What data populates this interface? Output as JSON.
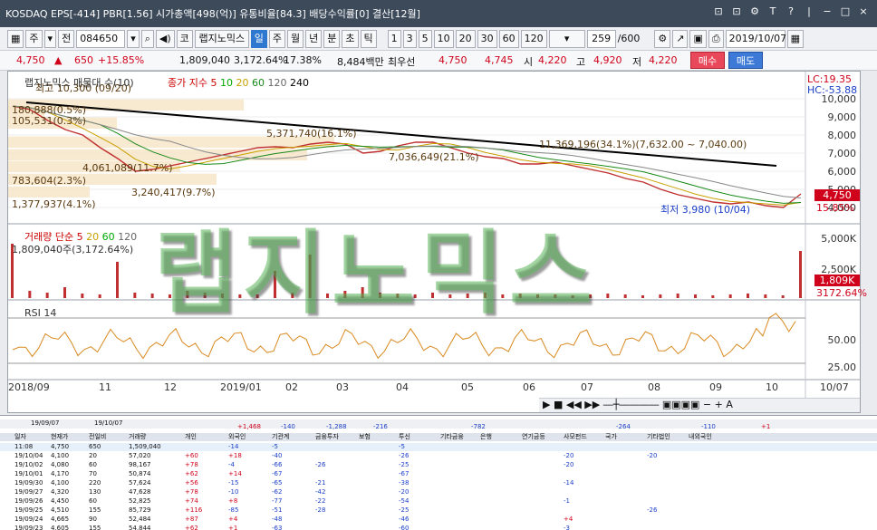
{
  "titlebar": {
    "text": "KOSDAQ EPS[-414] PBR[1.56] 시가총액[498(억)] 유통비율[84.3] 배당수익률[0] 결산[12월]",
    "buttons": [
      "⊡",
      "⊡",
      "⚙",
      "T",
      "?",
      "|",
      "−",
      "□",
      "×"
    ]
  },
  "toolbar": {
    "market": "주",
    "jeon": "전",
    "code": "084650",
    "ko": "코",
    "name": "랩지노믹스",
    "periods": [
      "일",
      "주",
      "월",
      "년",
      "분",
      "초",
      "틱"
    ],
    "minutes": [
      "1",
      "3",
      "5",
      "10",
      "20",
      "30",
      "60",
      "120"
    ],
    "count": "259",
    "total": "/600",
    "date": "2019/10/07"
  },
  "quote": {
    "price": "4,750",
    "change": "650",
    "change_pct": "+15.85%",
    "volume": "1,809,040",
    "vol_pct": "3,172.64%",
    "turnover_pct": "17.38%",
    "amount": "8,484백만",
    "best_label": "최우선",
    "best_ask": "4,750",
    "best_bid": "4,745",
    "open_label": "시",
    "open": "4,220",
    "high_label": "고",
    "high": "4,920",
    "low_label": "저",
    "low": "4,220",
    "buy": "매수",
    "sell": "매도"
  },
  "chart_data": {
    "type": "line",
    "title": "랩지노믹스 매물대 수(10)",
    "legend": [
      "종가 지수 5",
      "10",
      "20",
      "60",
      "120",
      "240"
    ],
    "ylim": [
      3500,
      10500
    ],
    "y_ticks": [
      "10,000",
      "9,000",
      "8,000",
      "7,000",
      "6,000",
      "5,000",
      "4,000"
    ],
    "x_labels": [
      "2018/09",
      "11",
      "12",
      "2019/01",
      "02",
      "03",
      "04",
      "05",
      "06",
      "07",
      "08",
      "09",
      "10",
      "10/07"
    ],
    "lc": "LC:19.35",
    "hc": "HC:-53.88",
    "current_price": "4,750",
    "current_pct": "15.85%",
    "annotations": [
      "최고 10,300 (09/20)",
      "180,888(0.5%)",
      "105,531(0.3%)",
      "5,371,740(16.1%)",
      "4,061,089(11.7%)",
      "783,604(2.3%)",
      "3,240,417(9.7%)",
      "1,377,937(4.1%)",
      "7,036,649(21.1%)",
      "11,369,196(34.1%)(7,632.00 ~ 7,040.00)",
      "최저 3,980 (10/04)"
    ],
    "series": [
      {
        "values": [
          9600,
          9400,
          8800,
          8300,
          8000,
          7300,
          6700,
          6000,
          6100,
          6300,
          6500,
          6700,
          6900,
          7100,
          7300,
          7350,
          7300,
          7500,
          7600,
          7500,
          7000,
          7100,
          7400,
          7600,
          7600,
          7300,
          7000,
          6800,
          6700,
          6400,
          6400,
          6500,
          6300,
          6100,
          5900,
          5600,
          5400,
          5000,
          4700,
          4500,
          4300,
          4200,
          4300,
          4100,
          4000,
          4750
        ]
      }
    ],
    "volume": {
      "label": "거래량 단순 5",
      "legend": [
        "20",
        "60",
        "120"
      ],
      "current": "1,809,040주(3,172.64%)",
      "ticks": [
        "5,000K",
        "2,500K"
      ],
      "right_value": "1,809K",
      "right_pct": "3172.64%"
    },
    "rsi": {
      "label": "RSI 14",
      "ticks": [
        "50.00",
        "25.00"
      ]
    }
  },
  "table": {
    "filter_label1": "19/09/07",
    "filter_label2": "19/10/07",
    "summary": [
      "+1,468",
      "-140",
      "-1,288",
      "-216",
      "-782",
      "-264",
      "-110",
      "+1"
    ],
    "headers": [
      "일자",
      "현재가",
      "전일비",
      "거래량",
      "개인",
      "외국인",
      "기관계",
      "금융투자",
      "보험",
      "투신",
      "기타금융",
      "은행",
      "연기금등",
      "사모펀드",
      "국가",
      "기타법인",
      "내외국인"
    ],
    "rows": [
      [
        "11:08",
        "4,750",
        "650",
        "1,509,040",
        "",
        "-14",
        "-5",
        "",
        "",
        "-5",
        "",
        "",
        "",
        "",
        "",
        "",
        ""
      ],
      [
        "19/10/04",
        "4,100",
        "20",
        "57,020",
        "+60",
        "+18",
        "-40",
        "",
        "",
        "-26",
        "",
        "",
        "",
        "-20",
        "",
        "-20",
        ""
      ],
      [
        "19/10/02",
        "4,080",
        "60",
        "98,167",
        "+78",
        "-4",
        "-66",
        "-26",
        "",
        "-25",
        "",
        "",
        "",
        "-20",
        "",
        "",
        ""
      ],
      [
        "19/10/01",
        "4,170",
        "70",
        "50,874",
        "+62",
        "+14",
        "-67",
        "",
        "",
        "-67",
        "",
        "",
        "",
        "",
        "",
        "",
        ""
      ],
      [
        "19/09/30",
        "4,100",
        "220",
        "57,624",
        "+56",
        "-15",
        "-65",
        "-21",
        "",
        "-38",
        "",
        "",
        "",
        "-14",
        "",
        "",
        ""
      ],
      [
        "19/09/27",
        "4,320",
        "130",
        "47,628",
        "+78",
        "-10",
        "-62",
        "-42",
        "",
        "-20",
        "",
        "",
        "",
        "",
        "",
        "",
        ""
      ],
      [
        "19/09/26",
        "4,450",
        "60",
        "52,825",
        "+74",
        "+8",
        "-77",
        "-22",
        "",
        "-54",
        "",
        "",
        "",
        "-1",
        "",
        "",
        ""
      ],
      [
        "19/09/25",
        "4,510",
        "155",
        "85,729",
        "+116",
        "-85",
        "-51",
        "-28",
        "",
        "-25",
        "",
        "",
        "",
        "",
        "",
        "-26",
        ""
      ],
      [
        "19/09/24",
        "4,665",
        "90",
        "52,484",
        "+87",
        "+4",
        "-48",
        "",
        "",
        "-46",
        "",
        "",
        "",
        "+4",
        "",
        "",
        ""
      ],
      [
        "19/09/23",
        "4,605",
        "155",
        "54,844",
        "+62",
        "+1",
        "-63",
        "",
        "",
        "-60",
        "",
        "",
        "",
        "-3",
        "",
        "",
        ""
      ]
    ]
  }
}
